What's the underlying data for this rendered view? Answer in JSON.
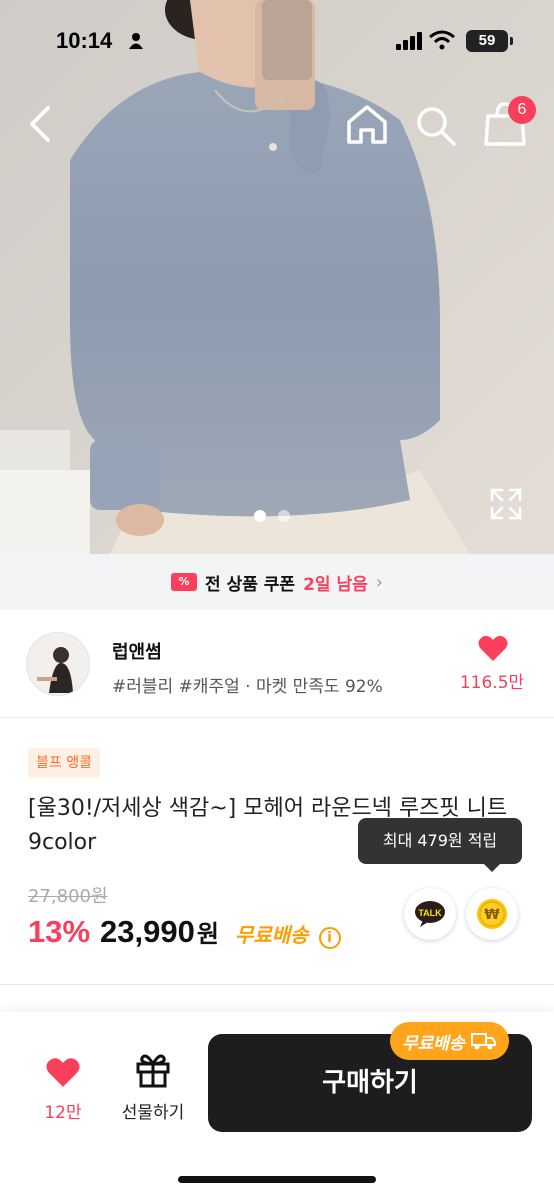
{
  "status_bar": {
    "time": "10:14",
    "battery": "59"
  },
  "nav": {
    "back_icon": "chevron-left-icon",
    "home_icon": "home-icon",
    "search_icon": "search-icon",
    "cart_icon": "shopping-bag-icon",
    "cart_badge": "6"
  },
  "carousel": {
    "total_images": 2,
    "current_index": 0
  },
  "coupon": {
    "label": "전 상품 쿠폰",
    "remaining": "2일 남음",
    "icon": "%"
  },
  "shop": {
    "name": "럽앤썸",
    "tags": "#러블리 #캐주얼 · 마켓 만족도 92%",
    "likes": "116.5만"
  },
  "product": {
    "promo_badge": "블프 앵콜",
    "title": "[울30!/저세상 색감~] 모헤어 라운드넥 루즈핏 니트 9color",
    "tooltip": "최대 479원 적립",
    "original_price": "27,800원",
    "discount": "13%",
    "price": "23,990",
    "price_unit": "원",
    "free_shipping": "무료배송",
    "info_icon": "i"
  },
  "actions": {
    "talk_label": "TALK",
    "won_symbol": "₩"
  },
  "bottom_bar": {
    "like_count": "12만",
    "gift_label": "선물하기",
    "buy_label": "구매하기",
    "shipping_pill": "무료배송"
  },
  "colors": {
    "accent": "#fa3f5c",
    "shipping": "#ff9d00",
    "buy_button": "#1d1d1d"
  }
}
